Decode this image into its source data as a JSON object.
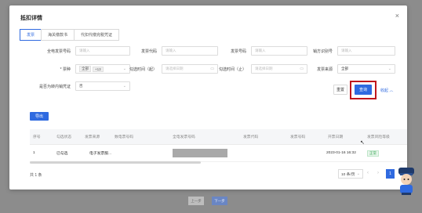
{
  "modal": {
    "title": "抵扣详情"
  },
  "tabs": [
    {
      "label": "发票",
      "active": true
    },
    {
      "label": "海关缴款书",
      "active": false
    },
    {
      "label": "代扣代缴完税凭证",
      "active": false
    }
  ],
  "filters": {
    "full_invoice_no": {
      "label": "全电发票号码",
      "placeholder": "请输入"
    },
    "invoice_code": {
      "label": "发票代码",
      "placeholder": "请输入"
    },
    "invoice_no": {
      "label": "发票号码",
      "placeholder": "请输入"
    },
    "seller_tax_id": {
      "label": "销方识别号",
      "placeholder": "请输入"
    },
    "ticket_type": {
      "label": "* 票种",
      "tag": "全部",
      "more": "+13"
    },
    "check_time_start": {
      "label": "勾选时间（起）",
      "placeholder": "请选择日期"
    },
    "check_time_end": {
      "label": "勾选时间（止）",
      "placeholder": "请选择日期"
    },
    "invoice_source": {
      "label": "发票来源",
      "value": "全部"
    },
    "is_reinvoiced": {
      "label": "是否为转内销凭证",
      "value": "否"
    }
  },
  "buttons": {
    "reset": "重置",
    "query": "查询",
    "collapse": "收起",
    "export": "导出"
  },
  "table": {
    "columns": [
      "序号",
      "勾选状态",
      "发票来源",
      "数电票号码",
      "全电发票号码",
      "发票代码",
      "发票号码",
      "开票日期",
      "发票风险等级"
    ],
    "rows": [
      {
        "index": "1",
        "check_status": "已勾选",
        "source": "电子发票服...",
        "date": "2023-01-16 16:32",
        "risk": "正常"
      }
    ]
  },
  "pagination": {
    "total": "共 1 条",
    "page_size": "10 条/页",
    "current": "1"
  },
  "bottom_buttons": {
    "prev": "上一步",
    "next": "下一步"
  },
  "colors": {
    "primary": "#2f6ae0",
    "highlight": "#c0161c",
    "ok": "#3aa757"
  }
}
